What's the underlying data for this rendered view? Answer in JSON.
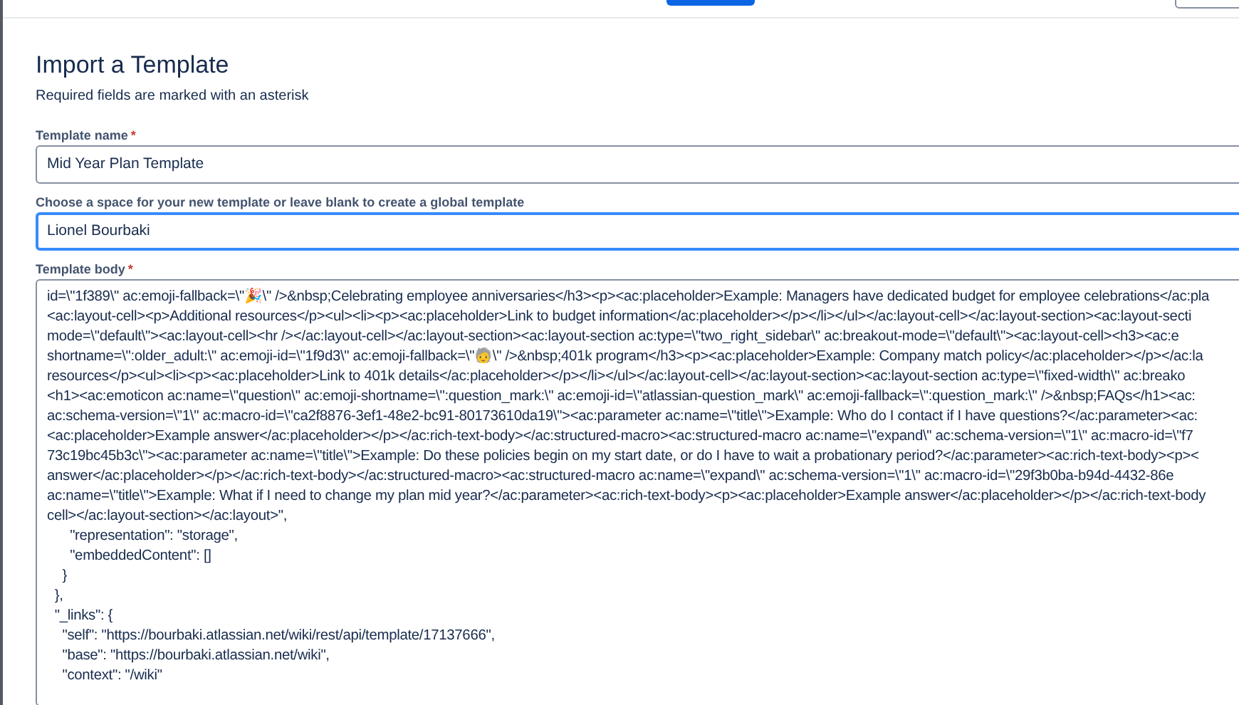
{
  "header": {
    "buttons": [
      {
        "kind": "primary"
      },
      {
        "kind": "secondary"
      }
    ]
  },
  "page": {
    "title": "Import a Template",
    "subtitle": "Required fields are marked with an asterisk"
  },
  "fields": [
    {
      "kind": "input",
      "label": "Template name",
      "required_mark": "*",
      "value": "Mid Year Plan Template",
      "focused": false
    },
    {
      "kind": "input",
      "label": "Choose a space for your new template or leave blank to create a global template",
      "value": "Lionel Bourbaki",
      "focused": true
    },
    {
      "kind": "textarea",
      "label": "Template body",
      "required_mark": "*",
      "focused": false,
      "lines": [
        "id=\\\"1f389\\\" ac:emoji-fallback=\\\"🎉\\\" />&nbsp;Celebrating employee anniversaries</h3><p><ac:placeholder>Example: Managers have dedicated budget for employee celebrations</ac:pla",
        "<ac:layout-cell><p>Additional resources</p><ul><li><p><ac:placeholder>Link to budget information</ac:placeholder></p></li></ul></ac:layout-cell></ac:layout-section><ac:layout-secti",
        "mode=\\\"default\\\"><ac:layout-cell><hr /></ac:layout-cell></ac:layout-section><ac:layout-section ac:type=\\\"two_right_sidebar\\\" ac:breakout-mode=\\\"default\\\"><ac:layout-cell><h3><ac:e",
        "shortname=\\\":older_adult:\\\" ac:emoji-id=\\\"1f9d3\\\" ac:emoji-fallback=\\\"🧓\\\" />&nbsp;401k program</h3><p><ac:placeholder>Example: Company match policy</ac:placeholder></p></ac:la",
        "resources</p><ul><li><p><ac:placeholder>Link to 401k details</ac:placeholder></p></li></ul></ac:layout-cell></ac:layout-section><ac:layout-section ac:type=\\\"fixed-width\\\" ac:breako",
        "<h1><ac:emoticon ac:name=\\\"question\\\" ac:emoji-shortname=\\\":question_mark:\\\" ac:emoji-id=\\\"atlassian-question_mark\\\" ac:emoji-fallback=\\\":question_mark:\\\" />&nbsp;FAQs</h1><ac:",
        "ac:schema-version=\\\"1\\\" ac:macro-id=\\\"ca2f8876-3ef1-48e2-bc91-80173610da19\\\"><ac:parameter ac:name=\\\"title\\\">Example: Who do I contact if I have questions?</ac:parameter><ac:",
        "<ac:placeholder>Example answer</ac:placeholder></p></ac:rich-text-body></ac:structured-macro><ac:structured-macro ac:name=\\\"expand\\\" ac:schema-version=\\\"1\\\" ac:macro-id=\\\"f7",
        "73c19bc45b3c\\\"><ac:parameter ac:name=\\\"title\\\">Example: Do these policies begin on my start date, or do I have to wait a probationary period?</ac:parameter><ac:rich-text-body><p><",
        "answer</ac:placeholder></p></ac:rich-text-body></ac:structured-macro><ac:structured-macro ac:name=\\\"expand\\\" ac:schema-version=\\\"1\\\" ac:macro-id=\\\"29f3b0ba-b94d-4432-86e",
        "ac:name=\\\"title\\\">Example: What if I need to change my plan mid year?</ac:parameter><ac:rich-text-body><p><ac:placeholder>Example answer</ac:placeholder></p></ac:rich-text-body",
        "cell></ac:layout-section></ac:layout>\",",
        "      \"representation\": \"storage\",",
        "      \"embeddedContent\": []",
        "    }",
        "  },",
        "  \"_links\": {",
        "    \"self\": \"https://bourbaki.atlassian.net/wiki/rest/api/template/17137666\",",
        "    \"base\": \"https://bourbaki.atlassian.net/wiki\",",
        "    \"context\": \"/wiki\""
      ]
    }
  ]
}
